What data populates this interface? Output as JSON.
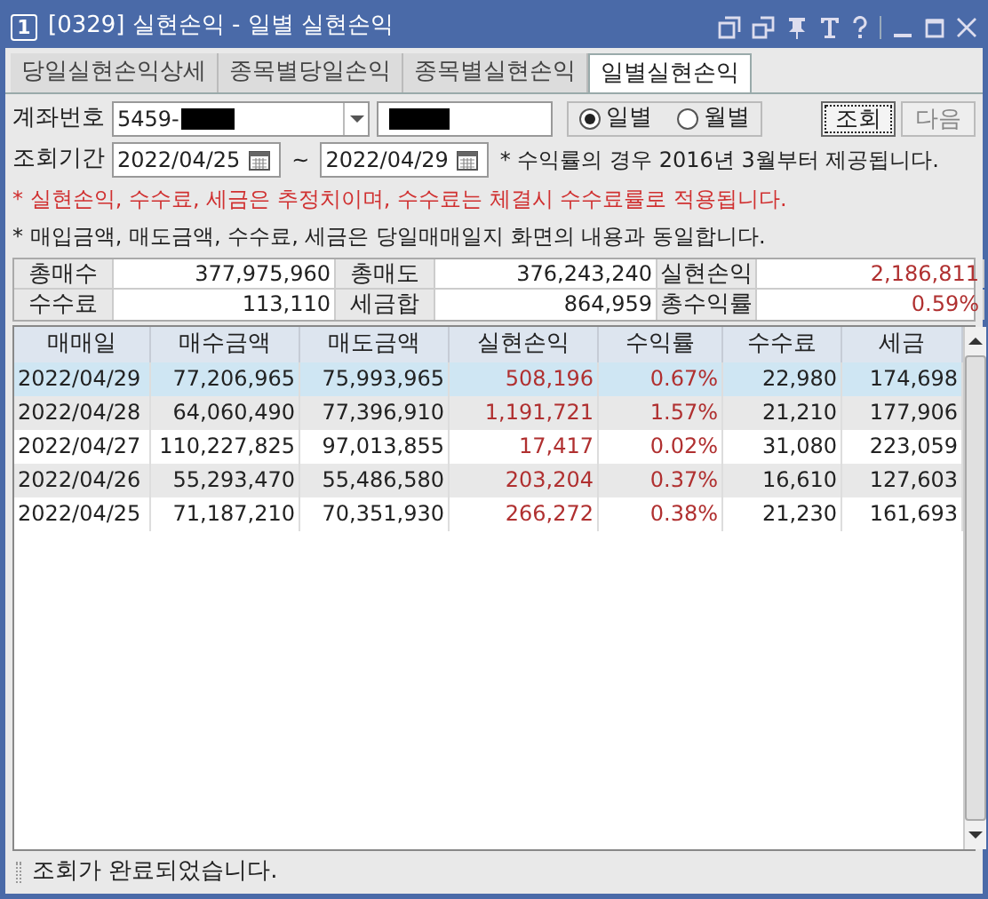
{
  "window": {
    "badge": "1",
    "title": "[0329] 실현손익 - 일별 실현손익"
  },
  "tabs": [
    {
      "label": "당일실현손익상세",
      "selected": false
    },
    {
      "label": "종목별당일손익",
      "selected": false
    },
    {
      "label": "종목별실현손익",
      "selected": false
    },
    {
      "label": "일별실현손익",
      "selected": true
    }
  ],
  "account": {
    "label": "계좌번호",
    "value": "5459-"
  },
  "period_options": [
    {
      "label": "일별",
      "selected": true
    },
    {
      "label": "월별",
      "selected": false
    }
  ],
  "buttons": [
    {
      "label": "조회",
      "disabled": false
    },
    {
      "label": "다음",
      "disabled": true
    }
  ],
  "period": {
    "label": "조회기간",
    "from": "2022/04/25",
    "separator": "~",
    "to": "2022/04/29"
  },
  "notes": [
    {
      "text": "* 수익률의 경우 2016년 3월부터 제공됩니다.",
      "warning": false
    },
    {
      "text": "* 실현손익, 수수료, 세금은 추정치이며, 수수료는 체결시 수수료률로 적용됩니다.",
      "warning": true
    },
    {
      "text": "* 매입금액, 매도금액, 수수료, 세금은 당일매매일지 화면의 내용과 동일합니다.",
      "warning": false
    }
  ],
  "summary": [
    [
      {
        "label": "총매수",
        "value": "377,975,960",
        "profit": false
      },
      {
        "label": "총매도",
        "value": "376,243,240",
        "profit": false
      },
      {
        "label": "실현손익",
        "value": "2,186,811",
        "profit": true
      }
    ],
    [
      {
        "label": "수수료",
        "value": "113,110",
        "profit": false
      },
      {
        "label": "세금합",
        "value": "864,959",
        "profit": false
      },
      {
        "label": "총수익률",
        "value": "0.59%",
        "profit": true
      }
    ]
  ],
  "table": {
    "columns": [
      "매매일",
      "매수금액",
      "매도금액",
      "실현손익",
      "수익률",
      "수수료",
      "세금"
    ],
    "rows": [
      {
        "cells": [
          "2022/04/29",
          "77,206,965",
          "75,993,965",
          "508,196",
          "0.67%",
          "22,980",
          "174,698"
        ],
        "selected": true
      },
      {
        "cells": [
          "2022/04/28",
          "64,060,490",
          "77,396,910",
          "1,191,721",
          "1.57%",
          "21,210",
          "177,906"
        ],
        "selected": false
      },
      {
        "cells": [
          "2022/04/27",
          "110,227,825",
          "97,013,855",
          "17,417",
          "0.02%",
          "31,080",
          "223,059"
        ],
        "selected": false
      },
      {
        "cells": [
          "2022/04/26",
          "55,293,470",
          "55,486,580",
          "203,204",
          "0.37%",
          "16,610",
          "127,603"
        ],
        "selected": false
      },
      {
        "cells": [
          "2022/04/25",
          "71,187,210",
          "70,351,930",
          "266,272",
          "0.38%",
          "21,230",
          "161,693"
        ],
        "selected": false
      }
    ]
  },
  "status_bar": "조회가 완료되었습니다."
}
